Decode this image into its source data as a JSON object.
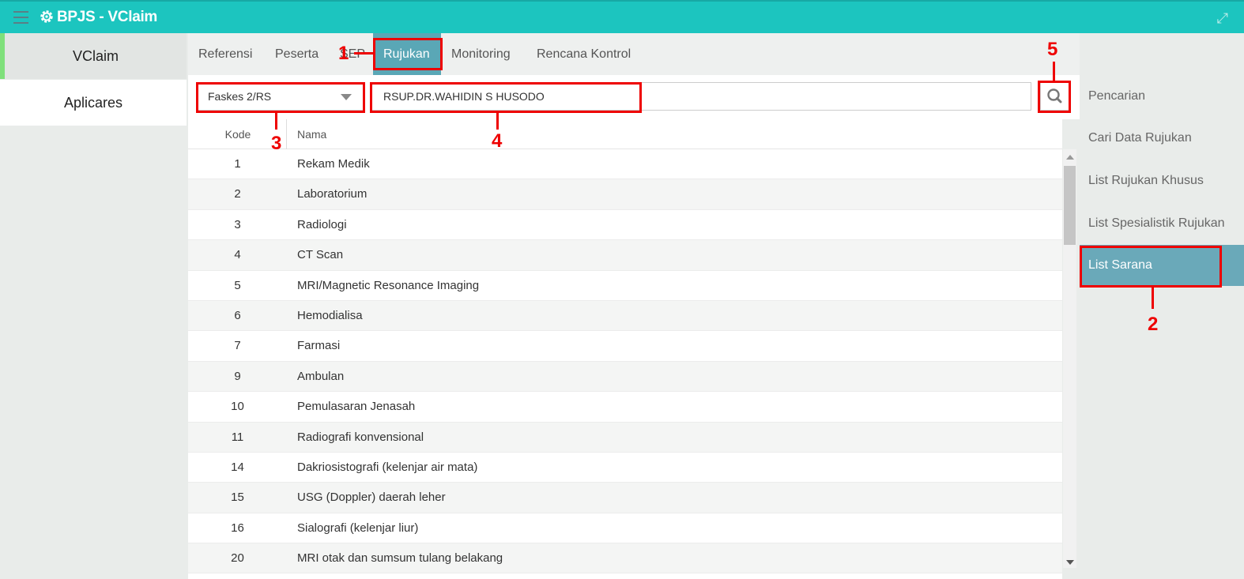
{
  "app": {
    "title": "BPJS - VClaim"
  },
  "leftnav": {
    "items": [
      "VClaim",
      "Aplicares"
    ]
  },
  "tabs": [
    "Referensi",
    "Peserta",
    "SEP",
    "Rujukan",
    "Monitoring",
    "Rencana Kontrol"
  ],
  "active_tab": "Rujukan",
  "search": {
    "faskes_selected": "Faskes 2/RS",
    "query": "RSUP.DR.WAHIDIN S HUSODO"
  },
  "table": {
    "headers": {
      "kode": "Kode",
      "nama": "Nama"
    },
    "rows": [
      {
        "kode": "1",
        "nama": "Rekam Medik"
      },
      {
        "kode": "2",
        "nama": "Laboratorium"
      },
      {
        "kode": "3",
        "nama": "Radiologi"
      },
      {
        "kode": "4",
        "nama": "CT Scan"
      },
      {
        "kode": "5",
        "nama": "MRI/Magnetic Resonance Imaging"
      },
      {
        "kode": "6",
        "nama": "Hemodialisa"
      },
      {
        "kode": "7",
        "nama": "Farmasi"
      },
      {
        "kode": "9",
        "nama": "Ambulan"
      },
      {
        "kode": "10",
        "nama": "Pemulasaran Jenasah"
      },
      {
        "kode": "11",
        "nama": "Radiografi konvensional"
      },
      {
        "kode": "14",
        "nama": "Dakriosistografi (kelenjar air mata)"
      },
      {
        "kode": "15",
        "nama": "USG (Doppler) daerah leher"
      },
      {
        "kode": "16",
        "nama": "Sialografi (kelenjar liur)"
      },
      {
        "kode": "20",
        "nama": "MRI otak dan sumsum tulang belakang"
      }
    ]
  },
  "rightmenu": {
    "items": [
      "Pencarian",
      "Cari Data Rujukan",
      "List Rujukan Khusus",
      "List Spesialistik Rujukan",
      "List Sarana"
    ],
    "active": "List Sarana"
  },
  "callouts": [
    "1",
    "2",
    "3",
    "4",
    "5"
  ],
  "colors": {
    "topbar": "#1cc5bf",
    "active_tab": "#5aa7b6",
    "active_menu": "#6aa9b9",
    "highlight": "#e00000"
  }
}
